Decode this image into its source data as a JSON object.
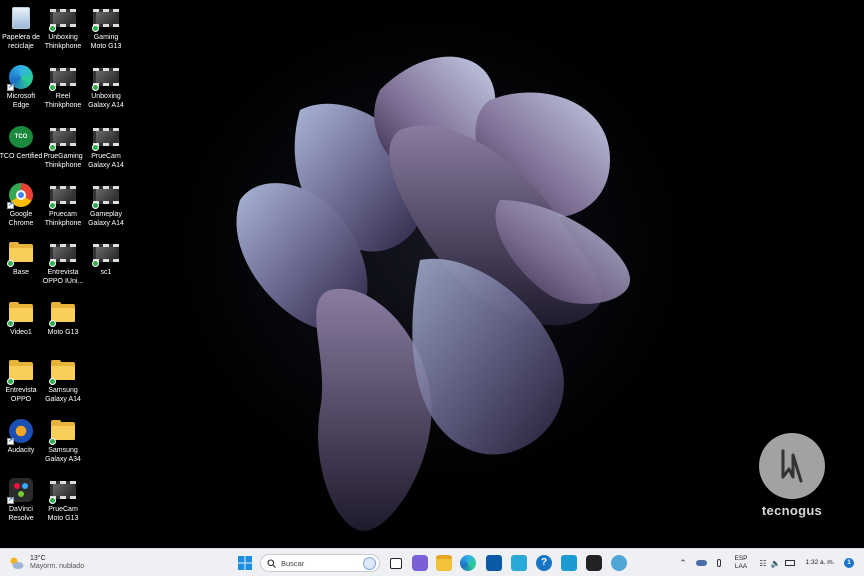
{
  "desktop": {
    "icons": [
      {
        "label": "Papelera de\nreciclaje",
        "icon": "recycle-bin-icon"
      },
      {
        "label": "Unboxing\nThinkphone",
        "icon": "video-file-icon"
      },
      {
        "label": "Gaming\nMoto G13",
        "icon": "video-file-icon"
      },
      {
        "label": "Microsoft\nEdge",
        "icon": "edge-icon"
      },
      {
        "label": "Reel\nThinkphone",
        "icon": "video-file-icon"
      },
      {
        "label": "Unboxing\nGalaxy A14",
        "icon": "video-file-icon"
      },
      {
        "label": "TCO Certified",
        "icon": "tco-certified-icon"
      },
      {
        "label": "PrueGaming\nThinkphone",
        "icon": "video-file-icon"
      },
      {
        "label": "PrueCam\nGalaxy A14",
        "icon": "video-file-icon"
      },
      {
        "label": "Google\nChrome",
        "icon": "chrome-icon"
      },
      {
        "label": "Pruecam\nThinkphone",
        "icon": "video-file-icon"
      },
      {
        "label": "Gameplay\nGalaxy A14",
        "icon": "video-file-icon"
      },
      {
        "label": "Base",
        "icon": "folder-icon"
      },
      {
        "label": "Entrevista\nOPPO IUni...",
        "icon": "video-file-icon"
      },
      {
        "label": "sc1",
        "icon": "video-file-icon"
      },
      {
        "label": "Video1",
        "icon": "folder-icon"
      },
      {
        "label": "Moto G13",
        "icon": "folder-icon"
      },
      {
        "label": "Entrevista\nOPPO",
        "icon": "folder-icon"
      },
      {
        "label": "Samsung\nGalaxy A14",
        "icon": "folder-icon"
      },
      {
        "label": "Audacity",
        "icon": "audacity-icon"
      },
      {
        "label": "Samsung\nGalaxy A34",
        "icon": "folder-icon"
      },
      {
        "label": "DaVinci\nResolve",
        "icon": "davinci-resolve-icon"
      },
      {
        "label": "PrueCam\nMoto G13",
        "icon": "video-file-icon"
      }
    ]
  },
  "watermark": {
    "text": "tecnogus"
  },
  "taskbar": {
    "weather": {
      "temp": "13°C",
      "desc": "Mayorm. nublado"
    },
    "search": {
      "placeholder": "Buscar"
    },
    "apps": [
      "windows-start-icon",
      "search",
      "task-view-icon",
      "teams-icon",
      "file-explorer-icon",
      "edge-icon",
      "store-icon",
      "audacity-icon",
      "help-icon",
      "fox-app-icon",
      "davinci-resolve-icon",
      "app-icon"
    ],
    "tray": {
      "lang_top": "ESP",
      "lang_bottom": "LAA",
      "time": "1:32 a. m.",
      "notif_count": "1"
    }
  }
}
